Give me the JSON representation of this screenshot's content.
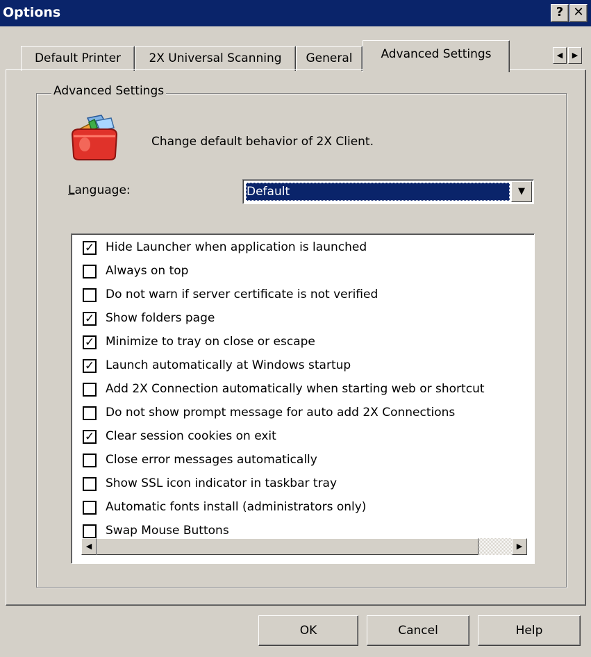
{
  "window": {
    "title": "Options",
    "help_glyph": "?",
    "close_glyph": "✕"
  },
  "tabs": [
    {
      "label": "Default Printer"
    },
    {
      "label": "2X Universal Scanning"
    },
    {
      "label": "General"
    },
    {
      "label": "Advanced Settings"
    }
  ],
  "tab_scroll": {
    "left_glyph": "◀",
    "right_glyph": "▶"
  },
  "group": {
    "title": "Advanced Settings",
    "description": "Change default behavior of 2X Client.",
    "icon": "toolbox-icon"
  },
  "language": {
    "label_accel": "L",
    "label_rest": "anguage:",
    "selected": "Default",
    "dropdown_glyph": "▼"
  },
  "options": [
    {
      "label": "Hide Launcher when application is launched",
      "checked": true
    },
    {
      "label": "Always on top",
      "checked": false
    },
    {
      "label": "Do not warn if server certificate is not verified",
      "checked": false
    },
    {
      "label": "Show folders page",
      "checked": true
    },
    {
      "label": "Minimize to tray on close or escape",
      "checked": true
    },
    {
      "label": "Launch automatically at Windows startup",
      "checked": true
    },
    {
      "label": "Add 2X Connection automatically when starting web or shortcut",
      "checked": false
    },
    {
      "label": "Do not show prompt message for auto add 2X Connections",
      "checked": false
    },
    {
      "label": "Clear session cookies on exit",
      "checked": true
    },
    {
      "label": "Close error messages automatically",
      "checked": false
    },
    {
      "label": "Show SSL icon indicator in taskbar tray",
      "checked": false
    },
    {
      "label": "Automatic fonts install (administrators only)",
      "checked": false
    },
    {
      "label": "Swap Mouse Buttons",
      "checked": false
    }
  ],
  "check_glyph": "✓",
  "scrollbar": {
    "left_glyph": "◀",
    "right_glyph": "▶"
  },
  "buttons": {
    "ok": "OK",
    "cancel": "Cancel",
    "help": "Help"
  },
  "colors": {
    "titlebar": "#0a246a",
    "face": "#d4d0c8",
    "selection": "#0a246a"
  }
}
